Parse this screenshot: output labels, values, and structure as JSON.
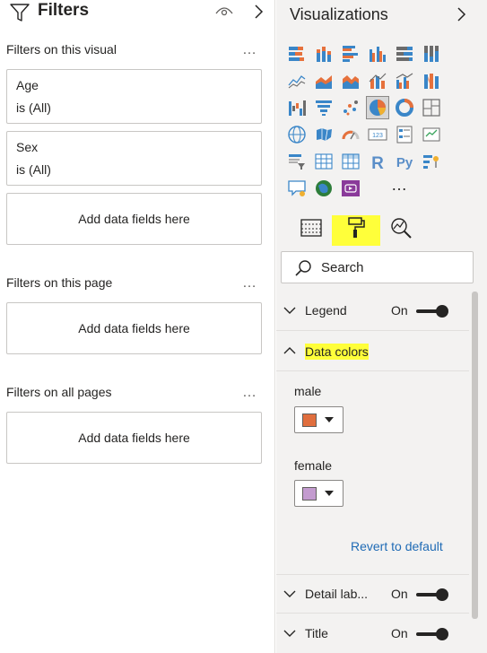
{
  "filters": {
    "title": "Filters",
    "sections": [
      {
        "title": "Filters on this visual",
        "more": "…"
      },
      {
        "title": "Filters on this page",
        "more": "…"
      },
      {
        "title": "Filters on all pages",
        "more": "…"
      }
    ],
    "visual_filters": [
      {
        "field": "Age",
        "value": "is (All)"
      },
      {
        "field": "Sex",
        "value": "is (All)"
      }
    ],
    "drop_label": "Add data fields here"
  },
  "visualizations": {
    "title": "Visualizations",
    "more": "…",
    "icons": [
      "stacked-bar-chart-icon",
      "stacked-column-chart-icon",
      "clustered-bar-chart-icon",
      "clustered-column-chart-icon",
      "100-stacked-bar-chart-icon",
      "100-stacked-column-chart-icon",
      "line-chart-icon",
      "area-chart-icon",
      "stacked-area-chart-icon",
      "line-and-stacked-column-icon",
      "line-and-clustered-column-icon",
      "ribbon-chart-icon",
      "waterfall-chart-icon",
      "funnel-icon",
      "scatter-chart-icon",
      "pie-chart-icon",
      "donut-chart-icon",
      "treemap-icon",
      "map-icon",
      "filled-map-icon",
      "gauge-icon",
      "card-icon",
      "multi-row-card-icon",
      "kpi-icon",
      "slicer-icon",
      "table-icon",
      "matrix-icon",
      "r-visual-icon",
      "python-visual-icon",
      "key-influencers-icon",
      "qa-icon",
      "arcgis-map-icon",
      "power-apps-icon"
    ],
    "selected_icon": "pie-chart-icon",
    "icon_labels": {
      "r": "R",
      "py": "Py",
      "card": "123"
    },
    "tabs": [
      "fields-icon",
      "format-paint-roller-icon",
      "analytics-icon"
    ],
    "active_tab": "format-paint-roller-icon",
    "search": {
      "placeholder": "Search"
    },
    "format_sections": {
      "legend": {
        "label": "Legend",
        "state": "On"
      },
      "data_colors": {
        "label": "Data colors",
        "items": [
          {
            "name": "male",
            "color": "#e06e3e"
          },
          {
            "name": "female",
            "color": "#c39bcf"
          }
        ],
        "revert": "Revert to default"
      },
      "detail_labels": {
        "label": "Detail lab...",
        "state": "On"
      },
      "title": {
        "label": "Title",
        "state": "On"
      }
    }
  },
  "colors": {
    "highlight": "#ffff3a",
    "link": "#1f6bb5",
    "pane_bg": "#f3f2f1"
  }
}
